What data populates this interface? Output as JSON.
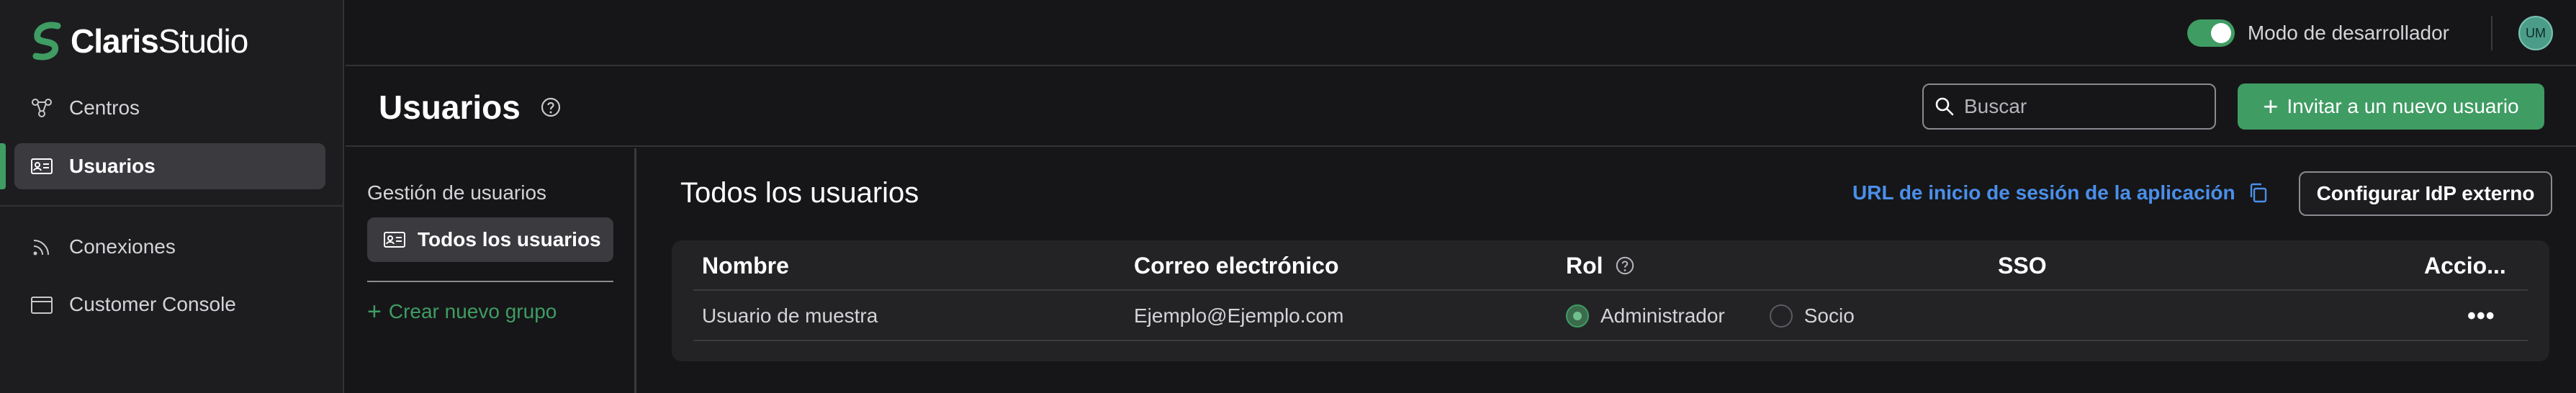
{
  "brand": {
    "name_bold": "Claris",
    "name_light": "Studio"
  },
  "sidebar": {
    "items": [
      {
        "label": "Centros",
        "icon": "hub-icon"
      },
      {
        "label": "Usuarios",
        "icon": "id-card-icon",
        "active": true
      },
      {
        "label": "Conexiones",
        "icon": "feed-icon"
      },
      {
        "label": "Customer Console",
        "icon": "window-icon"
      }
    ]
  },
  "topbar": {
    "dev_mode_label": "Modo de desarrollador",
    "dev_mode_on": true,
    "avatar_initials": "UM"
  },
  "header": {
    "title": "Usuarios",
    "search_placeholder": "Buscar",
    "invite_label": "Invitar a un nuevo usuario"
  },
  "subsidebar": {
    "title": "Gestión de usuarios",
    "groups": [
      {
        "label": "Todos los usuarios"
      }
    ],
    "create_group_label": "Crear nuevo grupo"
  },
  "main": {
    "section_title": "Todos los usuarios",
    "url_link": "URL de inicio de sesión de la aplicación",
    "idp_button": "Configurar IdP externo",
    "table": {
      "columns": [
        "Nombre",
        "Correo electrónico",
        "Rol",
        "SSO",
        "Accio..."
      ],
      "rows": [
        {
          "name": "Usuario de muestra",
          "email": "Ejemplo@Ejemplo.com",
          "role_options": [
            "Administrador",
            "Socio"
          ],
          "role_selected": "Administrador",
          "sso": "",
          "actions": "•••"
        }
      ]
    }
  },
  "colors": {
    "accent": "#3f9c63",
    "link": "#4a8fea",
    "background": "#161618"
  }
}
